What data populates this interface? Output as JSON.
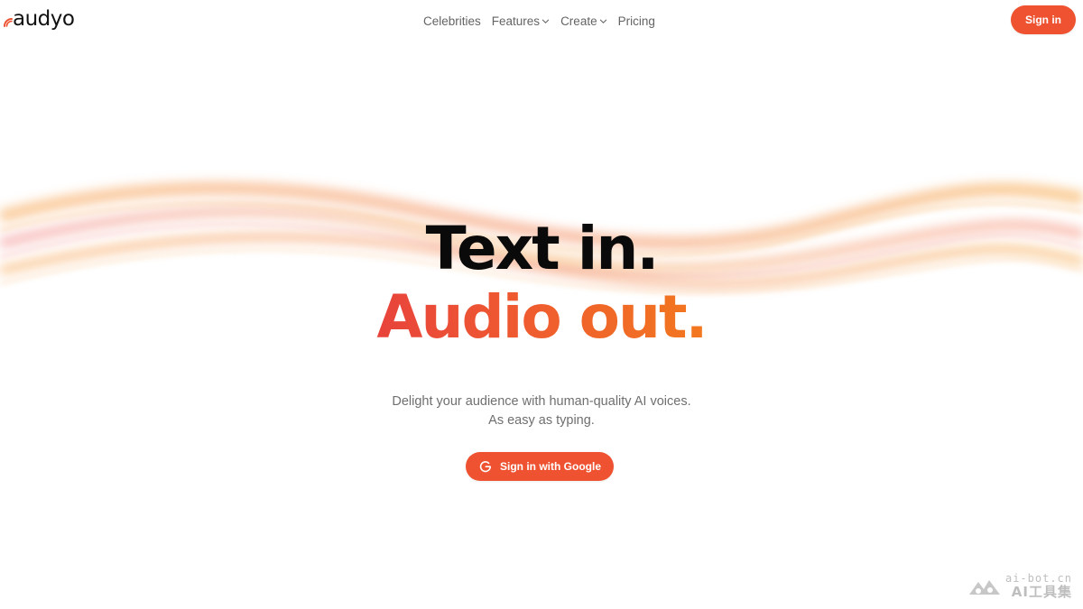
{
  "brand": {
    "name": "audyo",
    "accent_color": "#ee5230"
  },
  "nav": {
    "items": [
      {
        "label": "Celebrities",
        "has_dropdown": false
      },
      {
        "label": "Features",
        "has_dropdown": true,
        "icon": "chevron-down-icon"
      },
      {
        "label": "Create",
        "has_dropdown": true,
        "icon": "chevron-down-icon"
      },
      {
        "label": "Pricing",
        "has_dropdown": false
      }
    ]
  },
  "header": {
    "signin_label": "Sign in"
  },
  "hero": {
    "line1": "Text in.",
    "line2": "Audio out.",
    "gradient_colors": [
      "#e8433c",
      "#f2781f"
    ],
    "subtitle_line1": "Delight your audience with human-quality AI voices.",
    "subtitle_line2": "As easy as typing."
  },
  "cta": {
    "google_label": "Sign in with Google",
    "icon": "google-icon"
  },
  "watermark": {
    "line1": "ai-bot.cn",
    "line2": "AI工具集"
  }
}
